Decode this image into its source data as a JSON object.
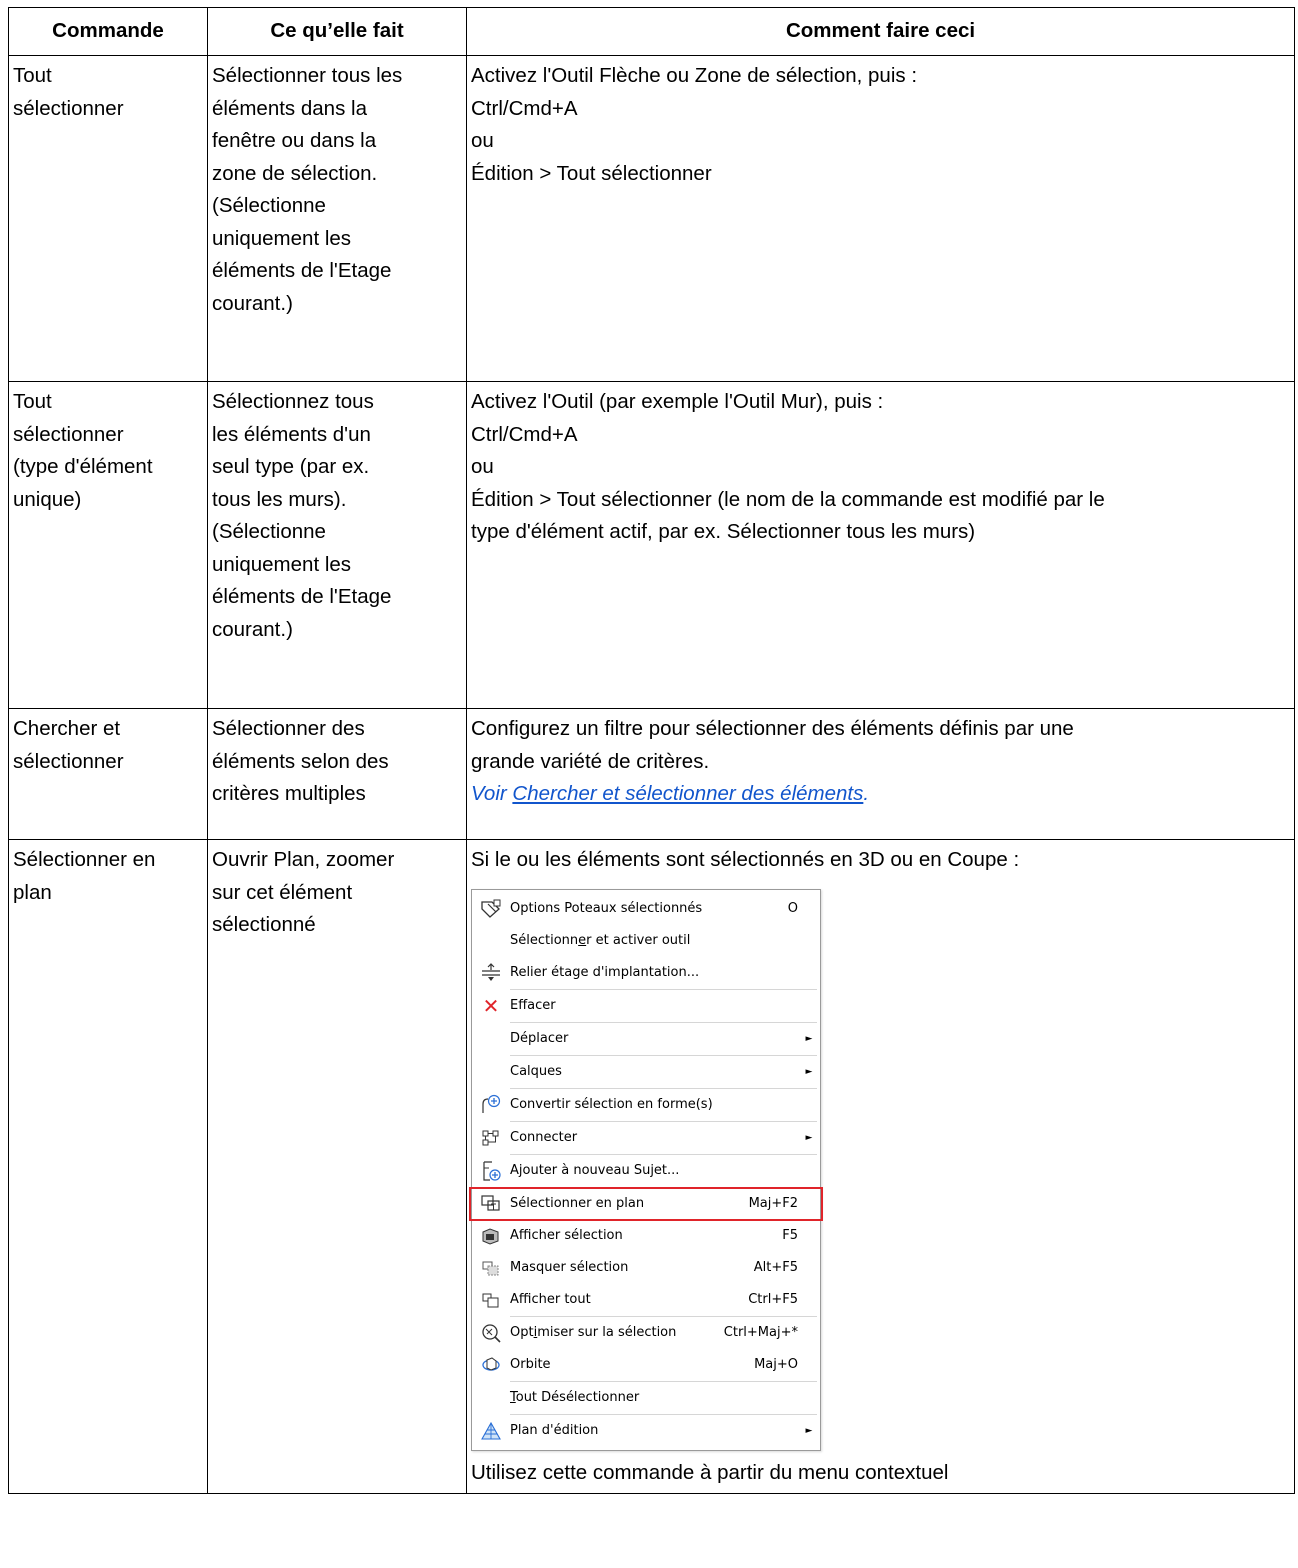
{
  "table": {
    "headers": [
      "Commande",
      "Ce qu’elle fait",
      "Comment faire ceci"
    ],
    "rows": [
      {
        "command": [
          "Tout",
          "sélectionner"
        ],
        "what": [
          "Sélectionner tous les",
          "éléments dans la",
          "fenêtre ou dans la",
          "zone de sélection.",
          "(Sélectionne",
          "uniquement les",
          "éléments de l'Etage",
          "courant.)"
        ],
        "how": [
          "Activez l'Outil Flèche ou Zone de sélection, puis :",
          "Ctrl/Cmd+A",
          "ou",
          "Édition > Tout sélectionner"
        ]
      },
      {
        "command": [
          "Tout",
          "sélectionner",
          "(type d'élément",
          "unique)"
        ],
        "what": [
          "Sélectionnez tous",
          "les éléments d'un",
          "seul type (par ex.",
          "tous les murs).",
          "(Sélectionne",
          "uniquement les",
          "éléments de l'Etage",
          "courant.)"
        ],
        "how": [
          "Activez l'Outil (par exemple l'Outil Mur), puis :",
          "Ctrl/Cmd+A",
          "ou",
          "Édition > Tout sélectionner (le nom de la commande est modifié par le",
          "type d'élément actif, par ex. Sélectionner tous les murs)"
        ]
      },
      {
        "command": [
          "Chercher et",
          "sélectionner"
        ],
        "what": [
          "Sélectionner des",
          "éléments selon des",
          "critères multiples"
        ],
        "how": [
          "Configurez un filtre pour sélectionner des éléments définis par une",
          "grande variété de critères."
        ],
        "see_prefix": "Voir ",
        "see_link": "Chercher et sélectionner des éléments",
        "see_suffix": "."
      },
      {
        "command": [
          "Sélectionner en",
          "plan"
        ],
        "what": [
          "Ouvrir Plan, zoomer",
          "sur cet élément",
          "sélectionné"
        ],
        "how_intro": "Si le ou les éléments sont sélectionnés en 3D ou en Coupe :",
        "how_outro": "Utilisez cette commande à partir du menu contextuel"
      }
    ]
  },
  "menu": {
    "items": [
      {
        "label": "Options Poteaux sélectionnés",
        "shortcut": "O",
        "icon": "column-settings-icon"
      },
      {
        "label": "Sélectionner et activer outil",
        "shortcut": "",
        "icon": ""
      },
      {
        "label": "Relier étage d'implantation...",
        "shortcut": "",
        "icon": "story-link-icon"
      },
      {
        "label": "Effacer",
        "shortcut": "",
        "icon": "delete-icon"
      },
      {
        "label": "Déplacer",
        "shortcut": "",
        "icon": "",
        "submenu": true
      },
      {
        "label": "Calques",
        "shortcut": "",
        "icon": "",
        "submenu": true
      },
      {
        "label": "Convertir sélection en forme(s)",
        "shortcut": "",
        "icon": "convert-morph-icon"
      },
      {
        "label": "Connecter",
        "shortcut": "",
        "icon": "connect-icon",
        "submenu": true
      },
      {
        "label": "Ajouter à nouveau Sujet...",
        "shortcut": "",
        "icon": "add-topic-icon"
      },
      {
        "label": "Sélectionner en plan",
        "shortcut": "Maj+F2",
        "icon": "select-in-plan-icon"
      },
      {
        "label": "Afficher sélection",
        "shortcut": "F5",
        "icon": "show-selection-icon"
      },
      {
        "label": "Masquer sélection",
        "shortcut": "Alt+F5",
        "icon": "hide-selection-icon"
      },
      {
        "label": "Afficher tout",
        "shortcut": "Ctrl+F5",
        "icon": "show-all-icon"
      },
      {
        "label": "Optimiser sur la sélection",
        "shortcut": "Ctrl+Maj+*",
        "icon": "zoom-selection-icon"
      },
      {
        "label": "Orbite",
        "shortcut": "Maj+O",
        "icon": "orbit-icon"
      },
      {
        "label": "Tout Désélectionner",
        "shortcut": "",
        "icon": ""
      },
      {
        "label": "Plan d'édition",
        "shortcut": "",
        "icon": "editing-plane-icon",
        "submenu": true
      }
    ],
    "highlight_color": "#e0242a",
    "submenu_arrow": "►"
  }
}
